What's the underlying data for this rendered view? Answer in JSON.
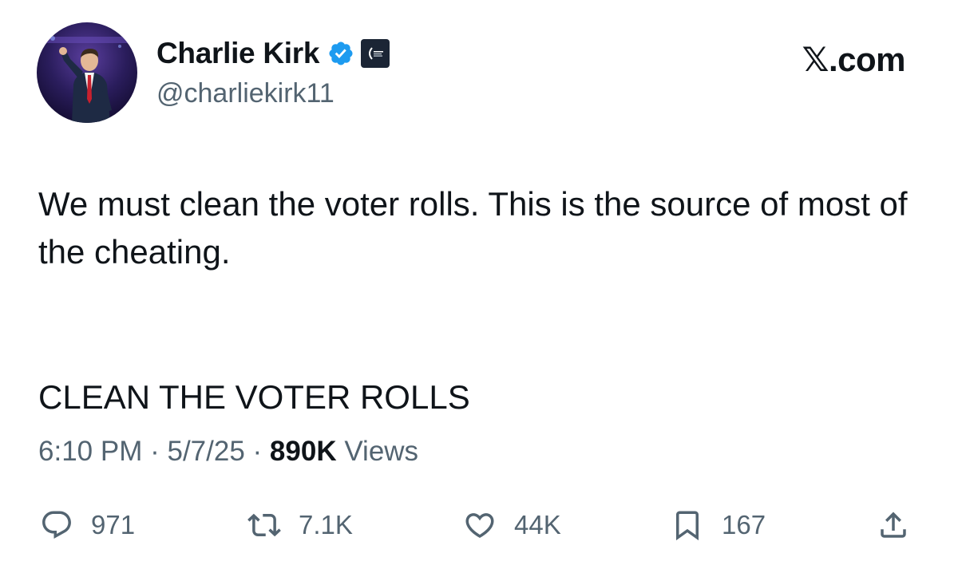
{
  "author": {
    "display_name": "Charlie Kirk",
    "handle": "@charliekirk11",
    "verified_icon": "verified-badge-icon",
    "affiliation_icon": "affiliation-badge-icon"
  },
  "brand": {
    "label": "𝕏.com"
  },
  "tweet": {
    "text_line_1": "We must clean the voter rolls. This is the source of most of the cheating.",
    "text_line_2": "CLEAN THE VOTER ROLLS"
  },
  "meta": {
    "time": "6:10 PM",
    "separator": "·",
    "date": "5/7/25",
    "views_count": "890K",
    "views_label": "Views"
  },
  "actions": {
    "replies": "971",
    "reposts": "7.1K",
    "likes": "44K",
    "bookmarks": "167"
  },
  "colors": {
    "text_primary": "#0f1419",
    "text_secondary": "#536471",
    "verified_blue": "#1d9bf0",
    "background": "#ffffff"
  }
}
